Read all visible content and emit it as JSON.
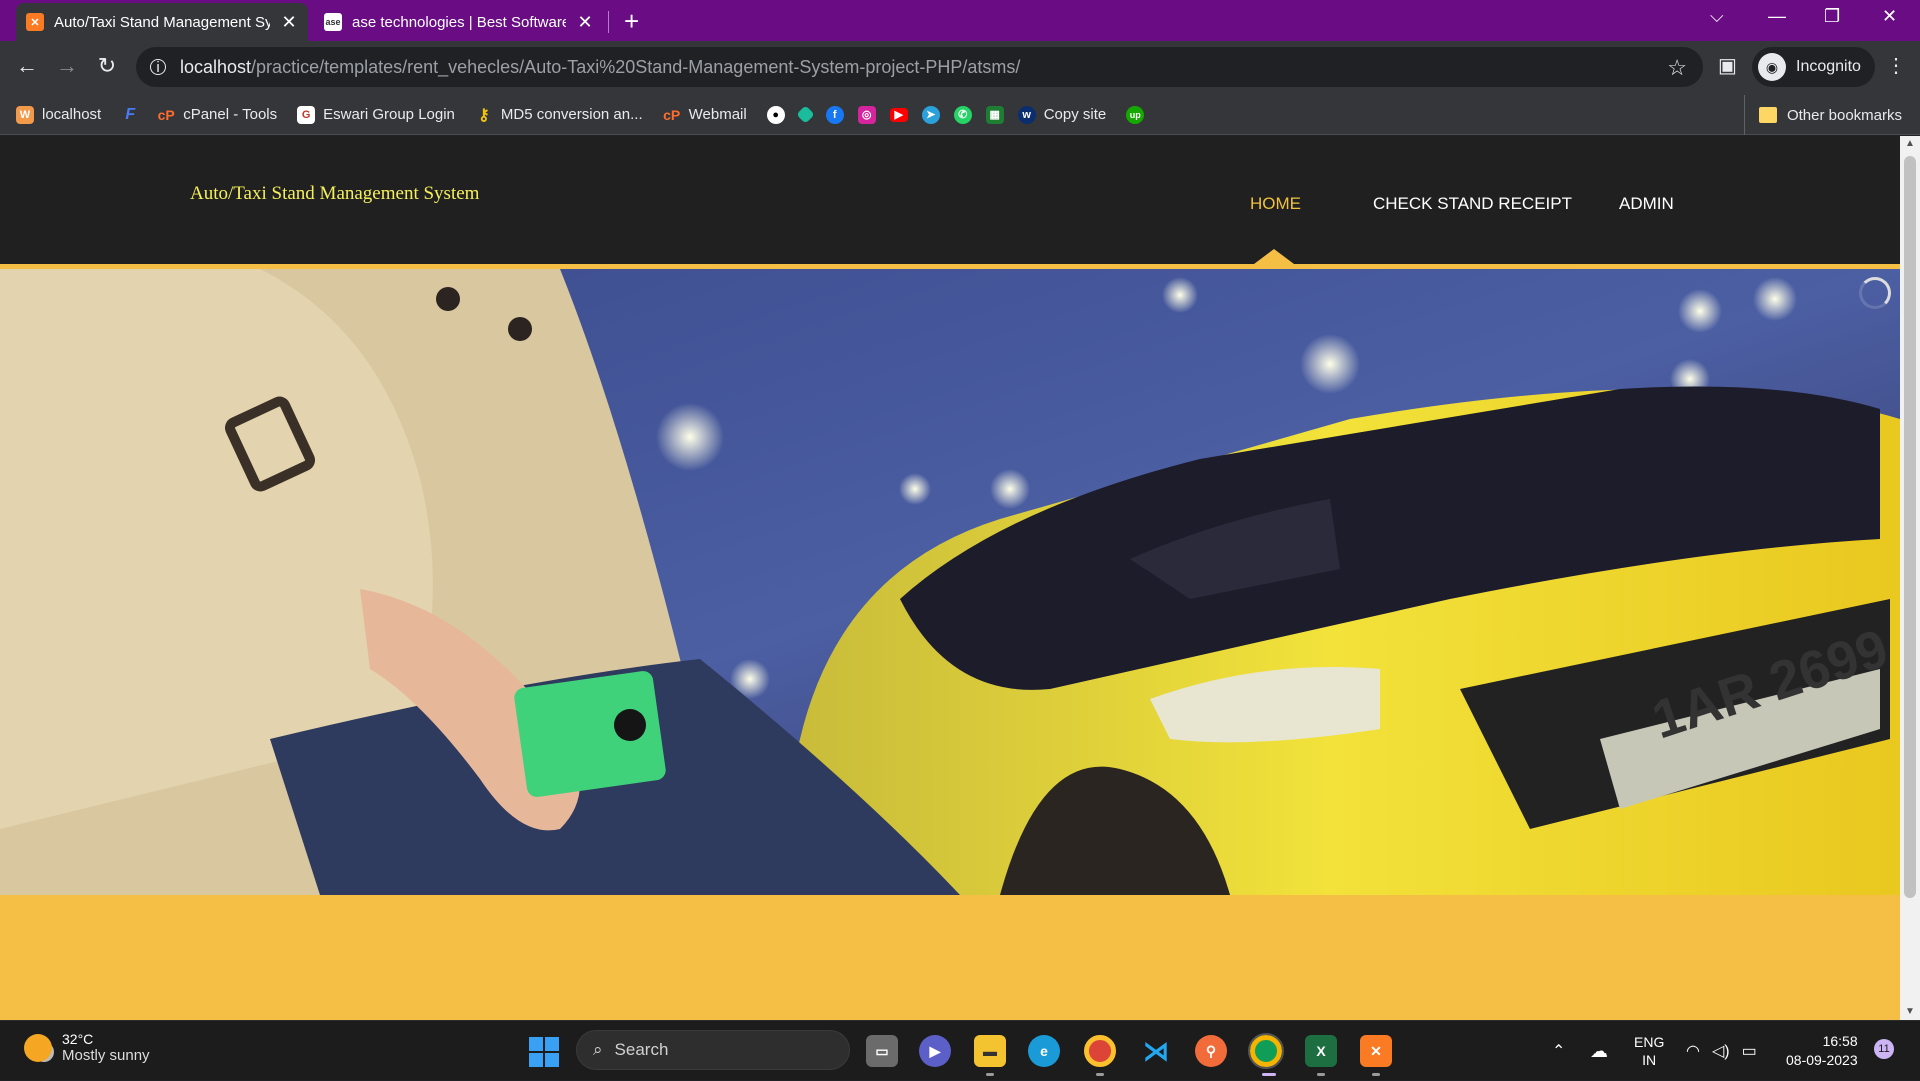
{
  "browser": {
    "tabs": [
      {
        "title": "Auto/Taxi Stand Management Sy",
        "favicon": "xampp-icon",
        "active": true
      },
      {
        "title": "ase technologies | Best Software",
        "favicon": "ase-icon",
        "active": false
      }
    ],
    "new_tab": "+",
    "url": {
      "host": "localhost",
      "path": "/practice/templates/rent_vehecles/Auto-Taxi%20Stand-Management-System-project-PHP/atsms/"
    },
    "profile_label": "Incognito",
    "bookmarks": [
      {
        "label": "localhost",
        "icon": "xampp-icon"
      },
      {
        "label": "",
        "icon": "fleetio-icon"
      },
      {
        "label": "cPanel - Tools",
        "icon": "cpanel-icon"
      },
      {
        "label": "Eswari Group Login",
        "icon": "eswari-icon"
      },
      {
        "label": "MD5 conversion an...",
        "icon": "key-icon"
      },
      {
        "label": "Webmail",
        "icon": "cpanel-icon"
      },
      {
        "label": "",
        "icon": "github-icon"
      },
      {
        "label": "",
        "icon": "diamond-icon"
      },
      {
        "label": "",
        "icon": "facebook-icon"
      },
      {
        "label": "",
        "icon": "instagram-icon"
      },
      {
        "label": "",
        "icon": "youtube-icon"
      },
      {
        "label": "",
        "icon": "telegram-icon"
      },
      {
        "label": "",
        "icon": "whatsapp-icon"
      },
      {
        "label": "",
        "icon": "grid-icon"
      },
      {
        "label": "Copy site",
        "icon": "w-icon"
      },
      {
        "label": "",
        "icon": "upwork-icon"
      }
    ],
    "other_bookmarks": "Other bookmarks"
  },
  "site": {
    "brand": "Auto/Taxi Stand Management System",
    "menu": [
      {
        "label": "HOME",
        "active": true
      },
      {
        "label": "CHECK STAND RECEIPT",
        "active": false
      },
      {
        "label": "ADMIN",
        "active": false
      }
    ],
    "colors": {
      "accent": "#f5bf45",
      "brand_text": "#f5f05a",
      "header_bg": "#202020"
    }
  },
  "taskbar": {
    "weather": {
      "temp": "32°C",
      "condition": "Mostly sunny"
    },
    "search_placeholder": "Search",
    "lang": {
      "line1": "ENG",
      "line2": "IN"
    },
    "time": "16:58",
    "date": "08-09-2023",
    "notifications": "11"
  }
}
